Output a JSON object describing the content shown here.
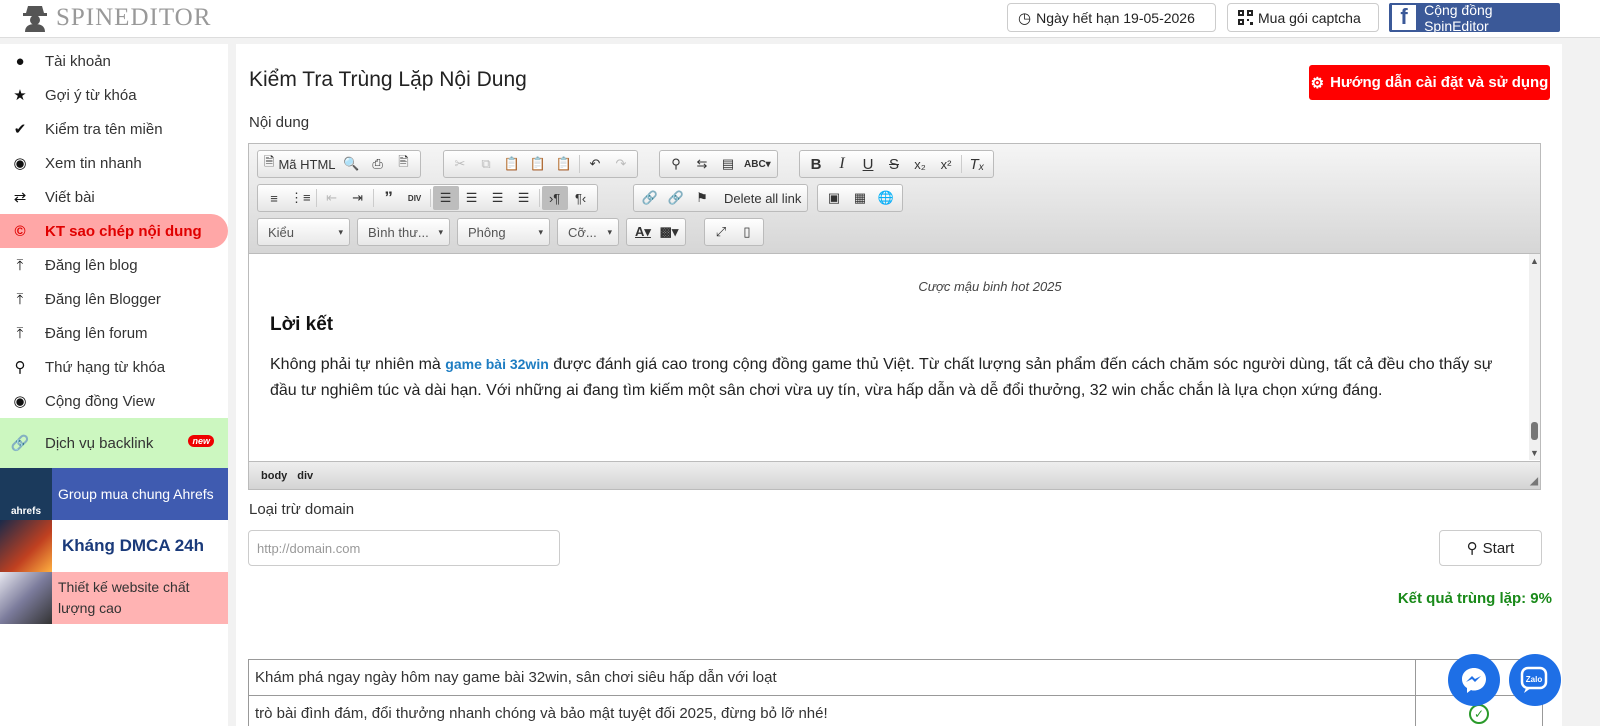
{
  "app": {
    "logo_text": "SPINEDITOR"
  },
  "top": {
    "expiry": "Ngày hết hạn 19-05-2026",
    "captcha": "Mua gói captcha",
    "community": "Cộng đồng SpinEditor"
  },
  "sidebar": {
    "items": [
      {
        "label": "Tài khoản",
        "icon": "user-icon"
      },
      {
        "label": "Gợi ý từ khóa",
        "icon": "star-icon"
      },
      {
        "label": "Kiểm tra tên miền",
        "icon": "check-icon"
      },
      {
        "label": "Xem tin nhanh",
        "icon": "eye-icon"
      },
      {
        "label": "Viết bài",
        "icon": "shuffle-icon"
      },
      {
        "label": "KT sao chép nội dung",
        "icon": "copyright-icon"
      },
      {
        "label": "Đăng lên blog",
        "icon": "upload-icon"
      },
      {
        "label": "Đăng lên Blogger",
        "icon": "upload-icon"
      },
      {
        "label": "Đăng lên forum",
        "icon": "upload-icon"
      },
      {
        "label": "Thứ hạng từ khóa",
        "icon": "search-icon"
      },
      {
        "label": "Cộng đồng View",
        "icon": "eye-icon"
      }
    ],
    "backlink": {
      "label": "Dịch vụ backlink",
      "badge": "new"
    },
    "promos": {
      "ahrefs": {
        "label": "Group mua chung Ahrefs",
        "thumb": "ahrefs"
      },
      "dmca": {
        "label": "Kháng DMCA 24h"
      },
      "web": {
        "label": "Thiết kế website chất lượng cao"
      }
    }
  },
  "main": {
    "title": "Kiểm Tra Trùng Lặp Nội Dung",
    "help_button": "Hướng dẫn cài đặt và sử dụng",
    "content_label": "Nội dung",
    "editor": {
      "toolbar": {
        "source": "Mã HTML",
        "delete_links": "Delete all link",
        "styles": "Kiểu",
        "format": "Bình thư...",
        "font": "Phông",
        "size": "Cỡ..."
      },
      "caption": "Cược mậu binh hot 2025",
      "heading": "Lời kết",
      "para_before": "Không phải tự nhiên mà ",
      "para_link": "game bài 32win",
      "para_after": " được đánh giá cao trong cộng đồng game thủ Việt. Từ chất lượng sản phẩm đến cách chăm sóc người dùng, tất cả đều cho thấy sự đầu tư nghiêm túc và dài hạn. Với những ai đang tìm kiếm một sân chơi vừa uy tín, vừa hấp dẫn và dễ đổi thưởng, 32 win chắc chắn là lựa chọn xứng đáng.",
      "status_body": "body",
      "status_div": "div"
    },
    "exclude_label": "Loại trừ domain",
    "exclude_placeholder": "http://domain.com",
    "start_button": "Start",
    "result": "Kết quả trùng lặp: 9%",
    "rows": [
      "Khám phá ngay ngày hôm nay game bài 32win, sân chơi siêu hấp dẫn với loạt",
      "trò bài đình đám, đổi thưởng nhanh chóng và bảo mật tuyệt đối 2025, đừng bỏ lỡ nhé!"
    ]
  }
}
